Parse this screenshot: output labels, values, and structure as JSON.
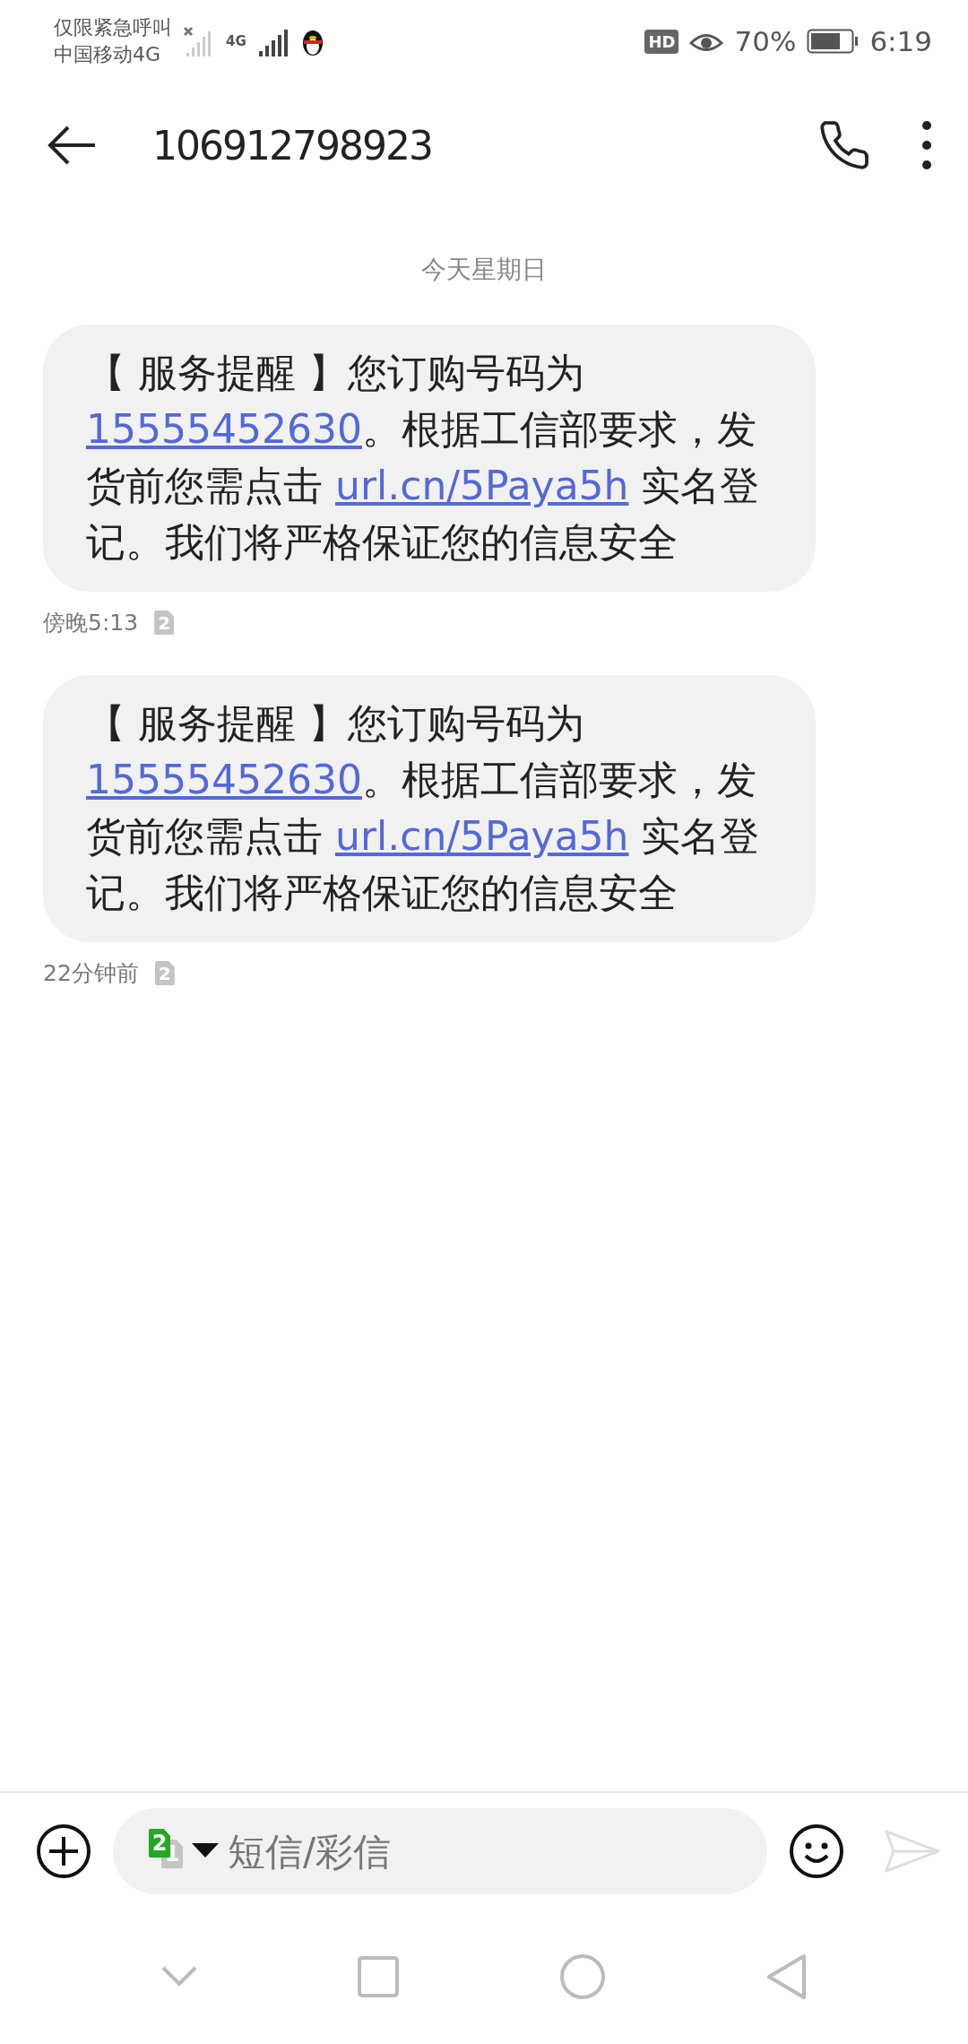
{
  "status_bar": {
    "lines": [
      "仅限紧急呼叫",
      "中国移动4G"
    ],
    "network": "4G",
    "hd": "HD",
    "battery": "70%",
    "time": "6:19"
  },
  "header": {
    "title": "106912798923"
  },
  "date_label": "今天星期日",
  "messages": [
    {
      "parts": [
        {
          "kind": "text",
          "text": "【 服务提醒 】您订购号码为"
        },
        {
          "kind": "link",
          "text": "15555452630"
        },
        {
          "kind": "text",
          "text": "。根据工信部要求，发货前您需点击 "
        },
        {
          "kind": "link",
          "text": "url.cn/5Paya5h"
        },
        {
          "kind": "text",
          "text": " 实名登记。我们将严格保证您的信息安全"
        }
      ],
      "time": "傍晚5:13",
      "sim": "2"
    },
    {
      "parts": [
        {
          "kind": "text",
          "text": "【 服务提醒 】您订购号码为"
        },
        {
          "kind": "link",
          "text": "15555452630"
        },
        {
          "kind": "text",
          "text": "。根据工信部要求，发货前您需点击 "
        },
        {
          "kind": "link",
          "text": "url.cn/5Paya5h"
        },
        {
          "kind": "text",
          "text": " 实名登记。我们将严格保证您的信息安全"
        }
      ],
      "time": "22分钟前",
      "sim": "2"
    }
  ],
  "composer": {
    "placeholder": "短信/彩信",
    "sim_front": "2",
    "sim_back": "1"
  }
}
